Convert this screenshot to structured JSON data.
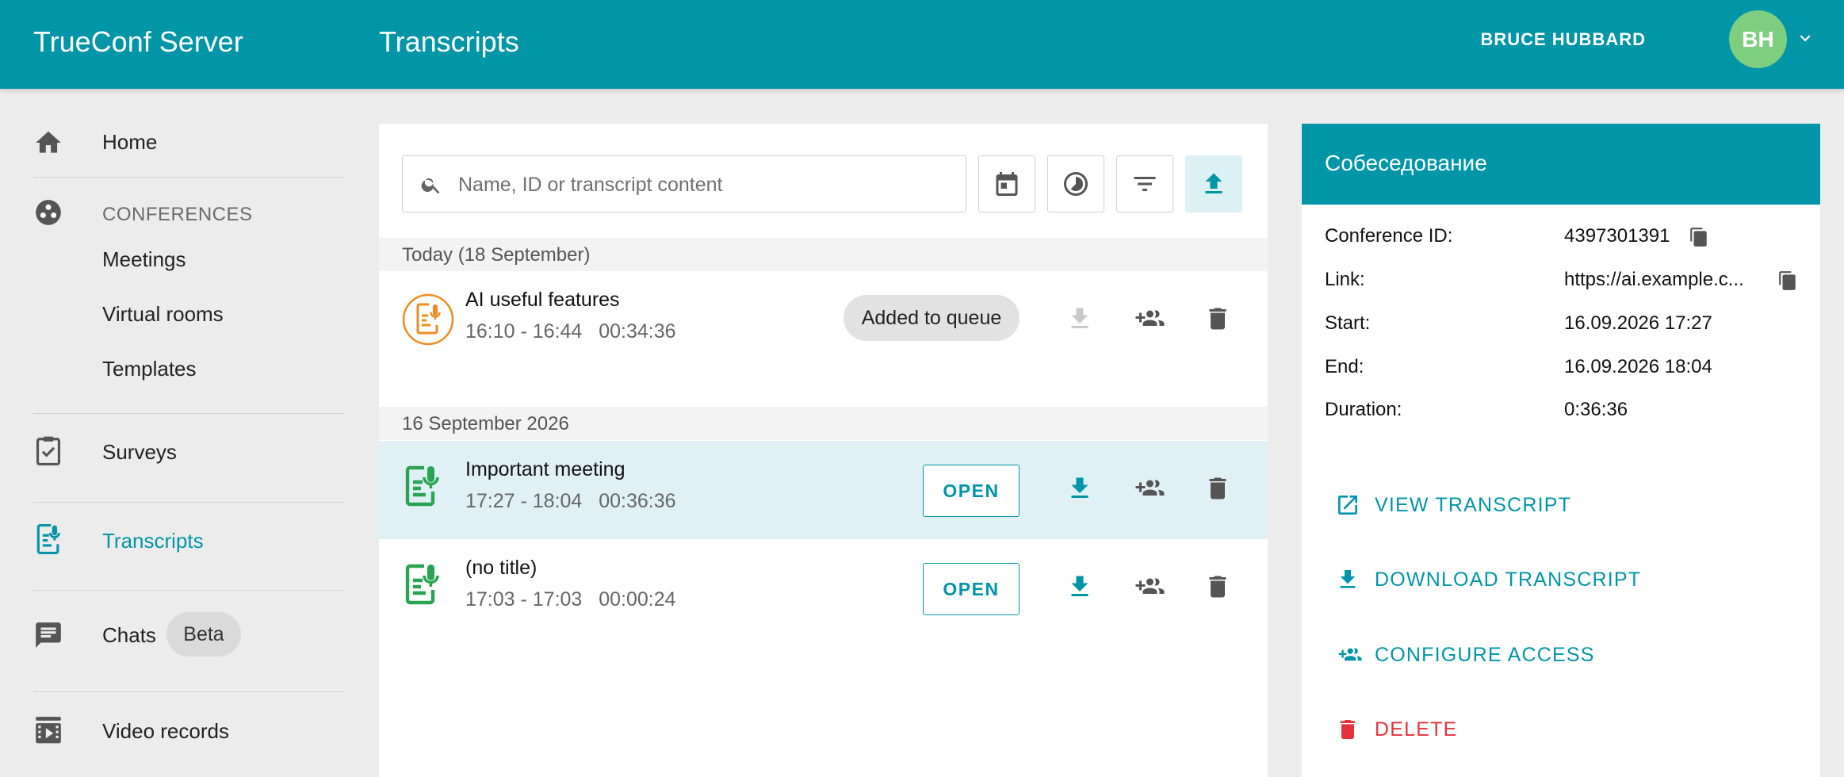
{
  "header": {
    "app_name": "TrueConf Server",
    "page_title": "Transcripts",
    "user_name": "BRUCE HUBBARD",
    "user_initials": "BH"
  },
  "sidebar": {
    "home": "Home",
    "conferences_section": "CONFERENCES",
    "meetings": "Meetings",
    "virtual_rooms": "Virtual rooms",
    "templates": "Templates",
    "surveys": "Surveys",
    "transcripts": "Transcripts",
    "chats": "Chats",
    "chats_badge": "Beta",
    "video_records": "Video records"
  },
  "search": {
    "placeholder": "Name, ID or transcript content",
    "value": ""
  },
  "groups": [
    {
      "label": "Today (18 September)",
      "items": [
        {
          "title": "AI useful features",
          "time": "16:10 - 16:44",
          "duration": "00:34:36",
          "status": "Added to queue"
        }
      ]
    },
    {
      "label": "16 September 2026",
      "items": [
        {
          "title": "Important meeting",
          "time": "17:27 - 18:04",
          "duration": "00:36:36",
          "action": "OPEN"
        },
        {
          "title": "(no title)",
          "time": "17:03 - 17:03",
          "duration": "00:00:24",
          "action": "OPEN"
        }
      ]
    }
  ],
  "details": {
    "title": "Собеседование",
    "conference_id_label": "Conference ID:",
    "conference_id": "4397301391",
    "link_label": "Link:",
    "link": "https://ai.example.c...",
    "start_label": "Start:",
    "start": "16.09.2026 17:27",
    "end_label": "End:",
    "end": "16.09.2026 18:04",
    "duration_label": "Duration:",
    "duration": "0:36:36",
    "actions": {
      "view": "VIEW TRANSCRIPT",
      "download": "DOWNLOAD TRANSCRIPT",
      "configure": "CONFIGURE ACCESS",
      "delete": "DELETE"
    }
  },
  "colors": {
    "primary": "#0195a8",
    "selected_row": "#dff1f4",
    "danger": "#e5323d",
    "status_orange": "#f08c1f",
    "status_green": "#2aa352",
    "avatar": "#7dcf7f"
  }
}
